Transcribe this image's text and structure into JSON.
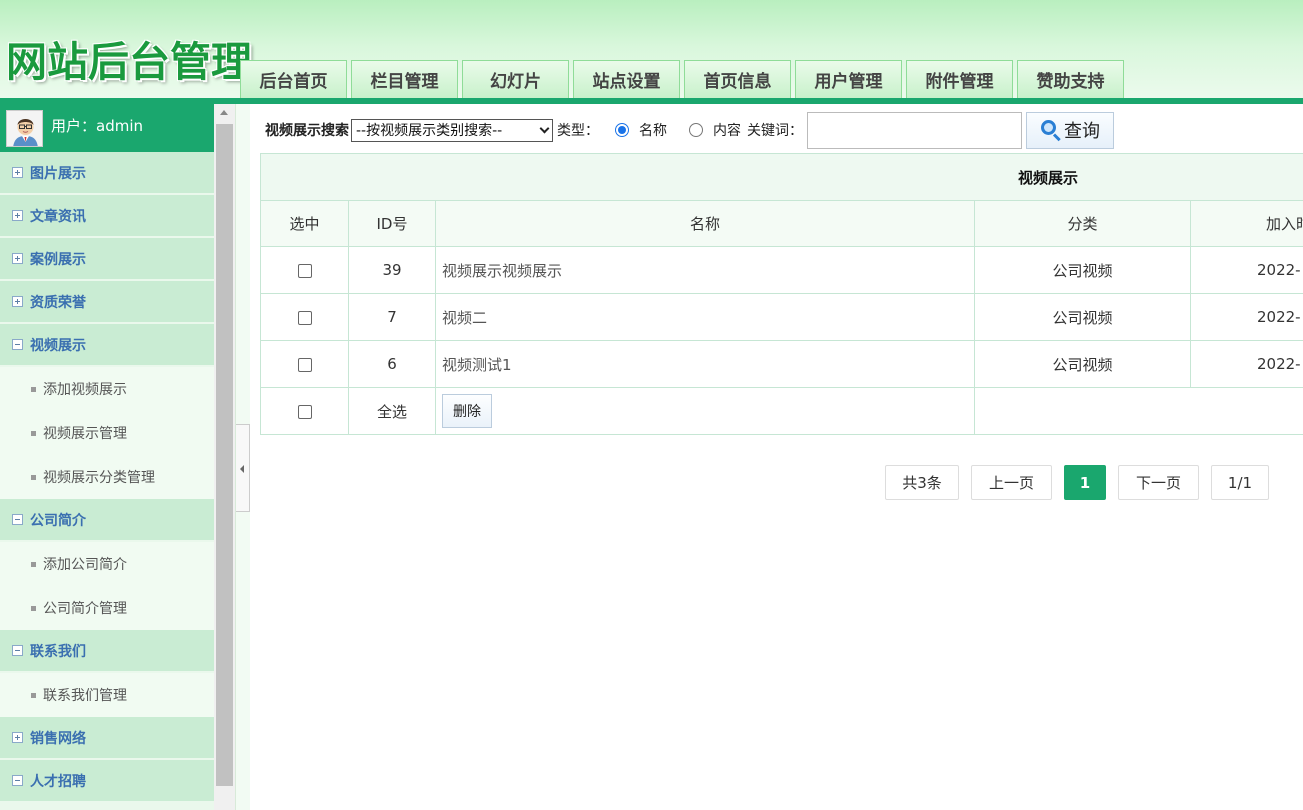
{
  "header": {
    "site_title": "网站后台管理",
    "nav": [
      "后台首页",
      "栏目管理",
      "幻灯片",
      "站点设置",
      "首页信息",
      "用户管理",
      "附件管理",
      "赞助支持"
    ]
  },
  "sidebar": {
    "user_label": "用户：admin",
    "groups": [
      {
        "label": "图片展示",
        "expanded": false
      },
      {
        "label": "文章资讯",
        "expanded": false
      },
      {
        "label": "案例展示",
        "expanded": false
      },
      {
        "label": "资质荣誉",
        "expanded": false
      },
      {
        "label": "视频展示",
        "expanded": true,
        "items": [
          "添加视频展示",
          "视频展示管理",
          "视频展示分类管理"
        ]
      },
      {
        "label": "公司简介",
        "expanded": true,
        "items": [
          "添加公司简介",
          "公司简介管理"
        ]
      },
      {
        "label": "联系我们",
        "expanded": true,
        "items": [
          "联系我们管理"
        ]
      },
      {
        "label": "销售网络",
        "expanded": false
      },
      {
        "label": "人才招聘",
        "expanded": true
      }
    ]
  },
  "search": {
    "title": "视频展示搜索",
    "category_selected": "--按视频展示类别搜索--",
    "type_label": "类型：",
    "option_name": "名称",
    "option_content": "内容",
    "keyword_label": "关键词：",
    "keyword_value": "",
    "button_label": "查询"
  },
  "table": {
    "caption": "视频展示",
    "headers": [
      "选中",
      "ID号",
      "名称",
      "分类",
      "加入时"
    ],
    "rows": [
      {
        "id": "39",
        "name": "视频展示视频展示",
        "category": "公司视频",
        "date": "2022-"
      },
      {
        "id": "7",
        "name": "视频二",
        "category": "公司视频",
        "date": "2022-"
      },
      {
        "id": "6",
        "name": "视频测试1",
        "category": "公司视频",
        "date": "2022-"
      }
    ],
    "select_all_label": "全选",
    "delete_label": "删除"
  },
  "pager": {
    "total": "共3条",
    "prev": "上一页",
    "current": "1",
    "next": "下一页",
    "pages": "1/1"
  },
  "colors": {
    "accent": "#1aa76e",
    "menu_group_bg": "#c9ecd3",
    "menu_text": "#3a6fb0"
  }
}
